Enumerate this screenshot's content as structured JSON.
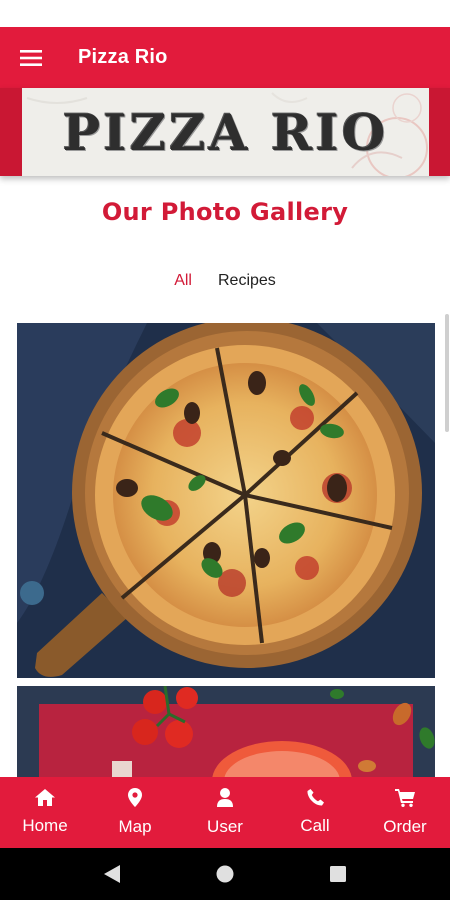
{
  "app_bar": {
    "title": "Pizza Rio",
    "menu_icon": "hamburger-menu-icon"
  },
  "banner": {
    "text": "PIZZA RIO"
  },
  "gallery": {
    "title": "Our Photo Gallery",
    "filters": [
      {
        "label": "All",
        "active": true
      },
      {
        "label": "Recipes",
        "active": false
      }
    ]
  },
  "bottom_nav": {
    "items": [
      {
        "label": "Home",
        "icon": "home-icon"
      },
      {
        "label": "Map",
        "icon": "map-pin-icon"
      },
      {
        "label": "User",
        "icon": "user-icon"
      },
      {
        "label": "Call",
        "icon": "phone-icon"
      },
      {
        "label": "Order",
        "icon": "cart-icon"
      }
    ]
  },
  "system_nav": {
    "icons": [
      "back-icon",
      "home-circle-icon",
      "recents-icon"
    ]
  },
  "colors": {
    "brand_red": "#e21b3c",
    "title_red": "#d21a37",
    "dark_text": "#222222"
  }
}
